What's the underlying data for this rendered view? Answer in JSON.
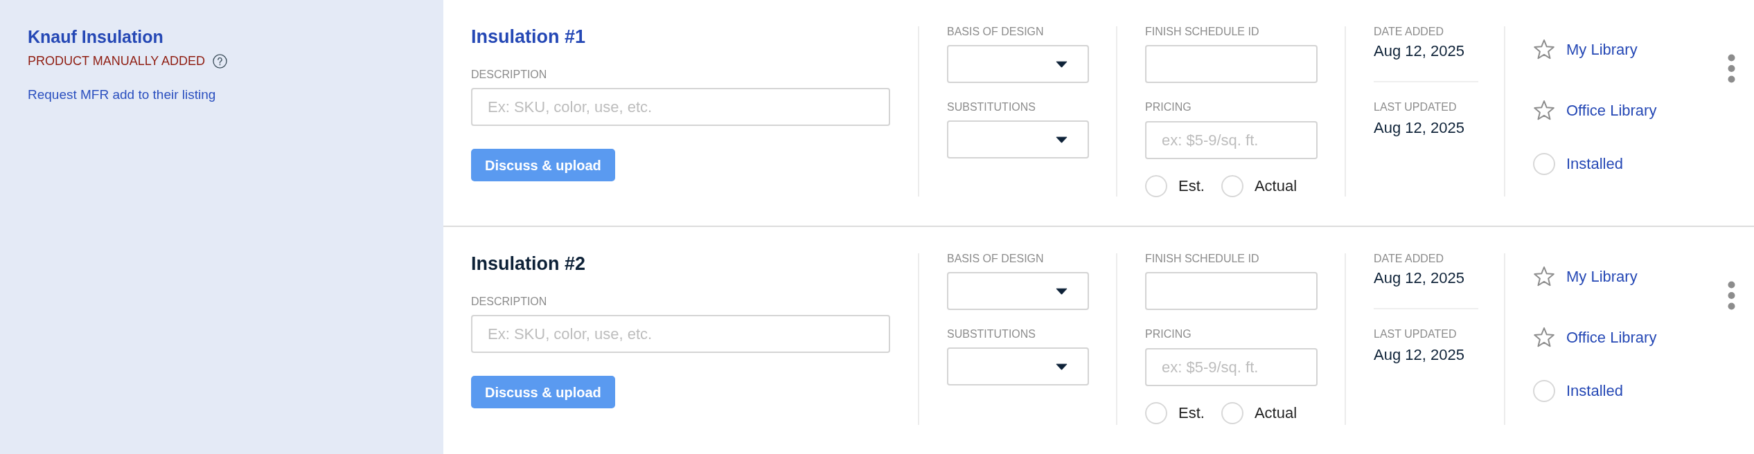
{
  "manufacturer": {
    "name": "Knauf Insulation",
    "status": "PRODUCT MANUALLY ADDED",
    "request_link": "Request MFR add to their listing"
  },
  "products": [
    {
      "title": "Insulation #1",
      "selected": true,
      "description": {
        "label": "DESCRIPTION",
        "placeholder": "Ex: SKU, color, use, etc."
      },
      "action_button": "Discuss & upload",
      "basis_of_design": {
        "label": "BASIS OF DESIGN"
      },
      "substitutions": {
        "label": "SUBSTITUTIONS"
      },
      "finish_schedule_id": {
        "label": "FINISH SCHEDULE ID"
      },
      "pricing": {
        "label": "PRICING",
        "placeholder": "ex: $5-9/sq. ft.",
        "options": [
          {
            "label": "Est.",
            "selected": false
          },
          {
            "label": "Actual",
            "selected": false
          }
        ]
      },
      "dates": [
        {
          "label": "DATE ADDED",
          "value": "Aug 12, 2025"
        },
        {
          "label": "LAST UPDATED",
          "value": "Aug 12, 2025"
        }
      ],
      "library_actions": [
        {
          "kind": "star",
          "label": "My Library",
          "checked": false
        },
        {
          "kind": "star",
          "label": "Office Library",
          "checked": false
        },
        {
          "kind": "circle",
          "label": "Installed",
          "checked": false
        }
      ]
    },
    {
      "title": "Insulation #2",
      "selected": false,
      "description": {
        "label": "DESCRIPTION",
        "placeholder": "Ex: SKU, color, use, etc."
      },
      "action_button": "Discuss & upload",
      "basis_of_design": {
        "label": "BASIS OF DESIGN"
      },
      "substitutions": {
        "label": "SUBSTITUTIONS"
      },
      "finish_schedule_id": {
        "label": "FINISH SCHEDULE ID"
      },
      "pricing": {
        "label": "PRICING",
        "placeholder": "ex: $5-9/sq. ft.",
        "options": [
          {
            "label": "Est.",
            "selected": false
          },
          {
            "label": "Actual",
            "selected": false
          }
        ]
      },
      "dates": [
        {
          "label": "DATE ADDED",
          "value": "Aug 12, 2025"
        },
        {
          "label": "LAST UPDATED",
          "value": "Aug 12, 2025"
        }
      ],
      "library_actions": [
        {
          "kind": "star",
          "label": "My Library",
          "checked": false
        },
        {
          "kind": "star",
          "label": "Office Library",
          "checked": false
        },
        {
          "kind": "circle",
          "label": "Installed",
          "checked": false
        }
      ]
    }
  ]
}
